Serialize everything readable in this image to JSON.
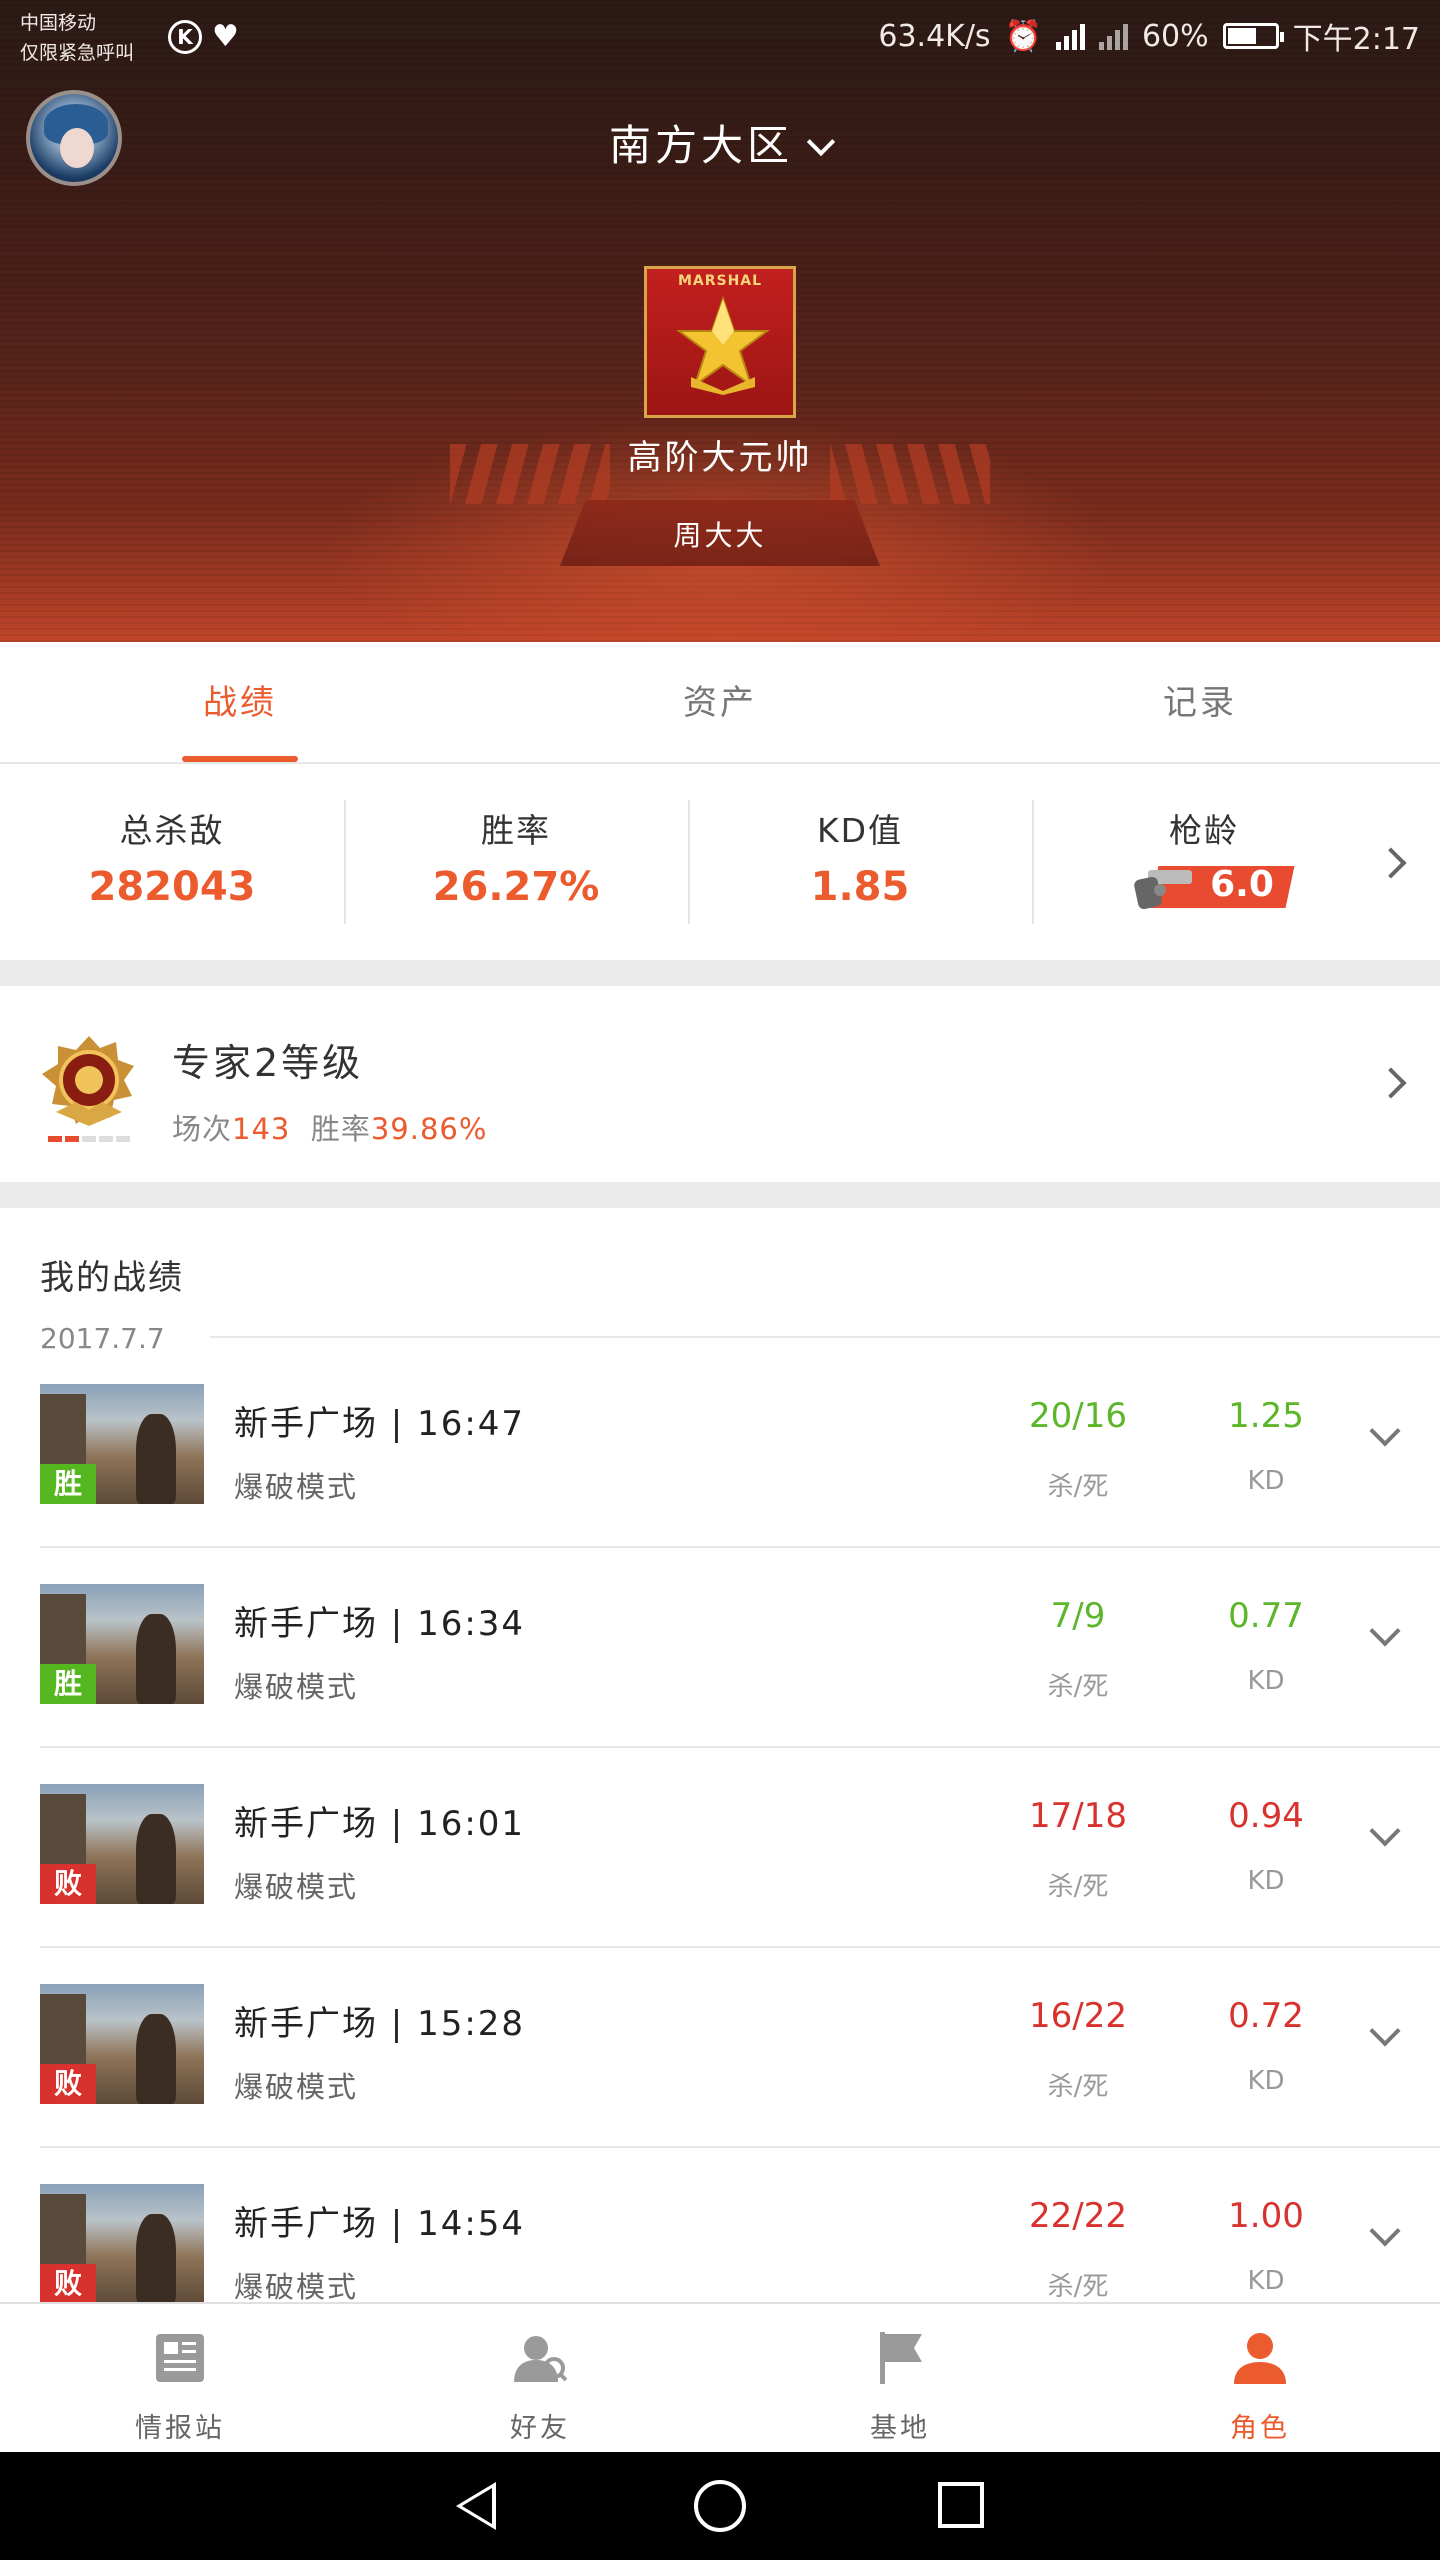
{
  "status_bar": {
    "carrier_line1": "中国移动",
    "carrier_line2": "仅限紧急呼叫",
    "speed": "63.4K/s",
    "battery": "60%",
    "time": "下午2:17"
  },
  "header": {
    "region": "南方大区",
    "badge_label": "MARSHAL",
    "rank": "高阶大元帅",
    "player_name": "周大大"
  },
  "tabs": [
    {
      "label": "战绩",
      "active": true
    },
    {
      "label": "资产",
      "active": false
    },
    {
      "label": "记录",
      "active": false
    }
  ],
  "stats": {
    "kills_label": "总杀敌",
    "kills_value": "282043",
    "winrate_label": "胜率",
    "winrate_value": "26.27%",
    "kd_label": "KD值",
    "kd_value": "1.85",
    "gun_age_label": "枪龄",
    "gun_age_value": "6.0"
  },
  "level": {
    "title": "专家2等级",
    "matches_label": "场次",
    "matches_value": "143",
    "winrate_label": "胜率",
    "winrate_value": "39.86%"
  },
  "battles": {
    "heading": "我的战绩",
    "date": "2017.7.7",
    "kd_caption": "杀/死",
    "kd_ratio_caption": "KD",
    "items": [
      {
        "result": "胜",
        "win": true,
        "map": "新手广场 | 16:47",
        "mode": "爆破模式",
        "kills_deaths": "20/16",
        "kd": "1.25"
      },
      {
        "result": "胜",
        "win": true,
        "map": "新手广场 | 16:34",
        "mode": "爆破模式",
        "kills_deaths": "7/9",
        "kd": "0.77"
      },
      {
        "result": "败",
        "win": false,
        "map": "新手广场 | 16:01",
        "mode": "爆破模式",
        "kills_deaths": "17/18",
        "kd": "0.94"
      },
      {
        "result": "败",
        "win": false,
        "map": "新手广场 | 15:28",
        "mode": "爆破模式",
        "kills_deaths": "16/22",
        "kd": "0.72"
      },
      {
        "result": "败",
        "win": false,
        "map": "新手广场 | 14:54",
        "mode": "爆破模式",
        "kills_deaths": "22/22",
        "kd": "1.00"
      }
    ]
  },
  "bottom_nav": [
    {
      "label": "情报站",
      "icon": "news-icon",
      "active": false
    },
    {
      "label": "好友",
      "icon": "friends-icon",
      "active": false
    },
    {
      "label": "基地",
      "icon": "flag-icon",
      "active": false
    },
    {
      "label": "角色",
      "icon": "person-icon",
      "active": true
    }
  ],
  "colors": {
    "accent": "#ec5b2d",
    "win": "#5bb62a",
    "lose": "#d8322e"
  }
}
